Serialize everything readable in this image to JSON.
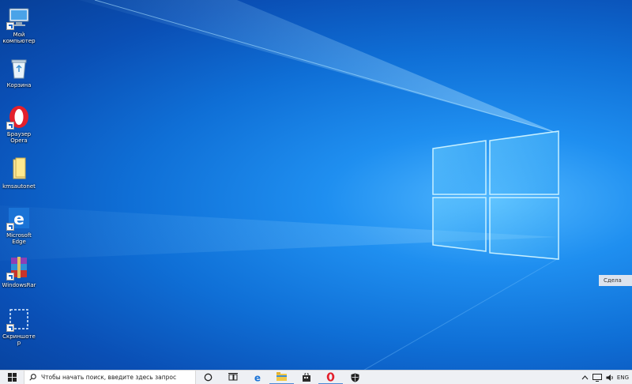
{
  "desktop_icons": [
    {
      "label": "Мой компьютер",
      "icon": "computer-icon",
      "shortcut": true
    },
    {
      "label": "Корзина",
      "icon": "recycle-bin-icon",
      "shortcut": false
    },
    {
      "label": "Браузер Opera",
      "icon": "opera-icon",
      "shortcut": true
    },
    {
      "label": "kmsautonet",
      "icon": "folder-icon",
      "shortcut": false
    },
    {
      "label": "Microsoft Edge",
      "icon": "edge-icon",
      "shortcut": true
    },
    {
      "label": "WindowsRar",
      "icon": "winrar-icon",
      "shortcut": true
    },
    {
      "label": "Скриншотер",
      "icon": "screenshot-icon",
      "shortcut": true
    }
  ],
  "side_tab": {
    "label": "Сдела"
  },
  "taskbar": {
    "search_placeholder": "Чтобы начать поиск, введите здесь запрос",
    "pinned": [
      "cortana-icon",
      "task-view-icon",
      "edge-icon",
      "file-explorer-icon",
      "store-icon",
      "opera-icon",
      "security-icon"
    ],
    "tray": {
      "language": "ENG"
    }
  },
  "colors": {
    "accent": "#0f6fd6",
    "taskbar": "#eef0f4"
  }
}
